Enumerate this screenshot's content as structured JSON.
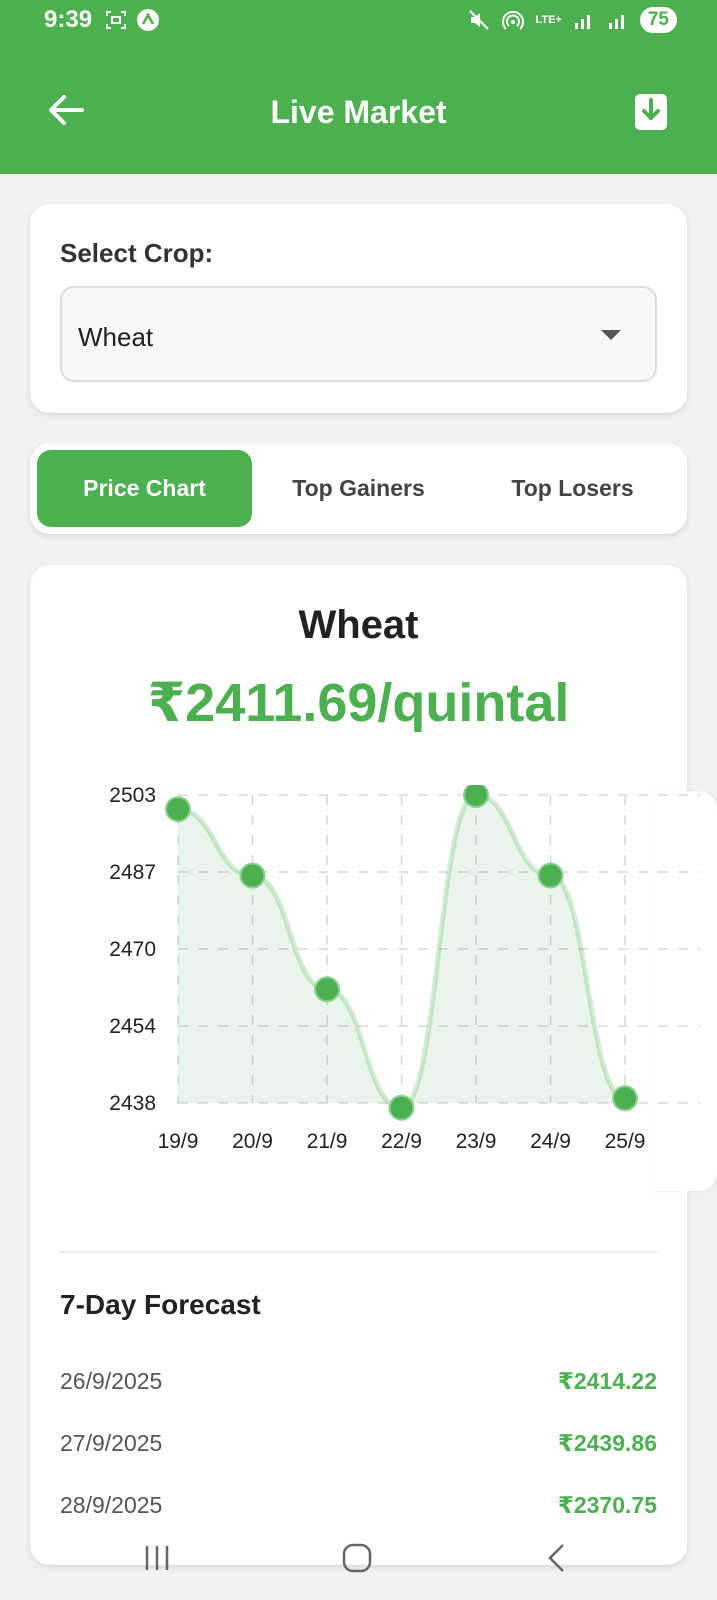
{
  "status_bar": {
    "time": "9:39",
    "network": "LTE+",
    "battery": "75"
  },
  "app_bar": {
    "title": "Live Market",
    "back_icon": "arrow-left-icon",
    "download_icon": "download-icon"
  },
  "crop_selector": {
    "label": "Select Crop:",
    "selected": "Wheat"
  },
  "tabs": [
    {
      "label": "Price Chart",
      "active": true
    },
    {
      "label": "Top Gainers",
      "active": false
    },
    {
      "label": "Top Losers",
      "active": false
    }
  ],
  "chart_card": {
    "crop_name": "Wheat",
    "price": "₹2411.69/quintal"
  },
  "chart_data": {
    "type": "line",
    "x": [
      "19/9",
      "20/9",
      "21/9",
      "22/9",
      "23/9",
      "24/9",
      "25/9"
    ],
    "values": [
      2500,
      2486,
      2462,
      2437,
      2503,
      2486,
      2439
    ],
    "y_ticks": [
      "2503",
      "2487",
      "2470",
      "2454",
      "2438"
    ],
    "ylim": [
      2438,
      2503
    ],
    "grid": true,
    "fill": true,
    "color": "#4caf50"
  },
  "forecast": {
    "title": "7-Day Forecast",
    "rows": [
      {
        "date": "26/9/2025",
        "price": "₹2414.22"
      },
      {
        "date": "27/9/2025",
        "price": "₹2439.86"
      },
      {
        "date": "28/9/2025",
        "price": "₹2370.75"
      }
    ]
  },
  "colors": {
    "primary": "#4caf50",
    "background": "#f2f2f2"
  }
}
